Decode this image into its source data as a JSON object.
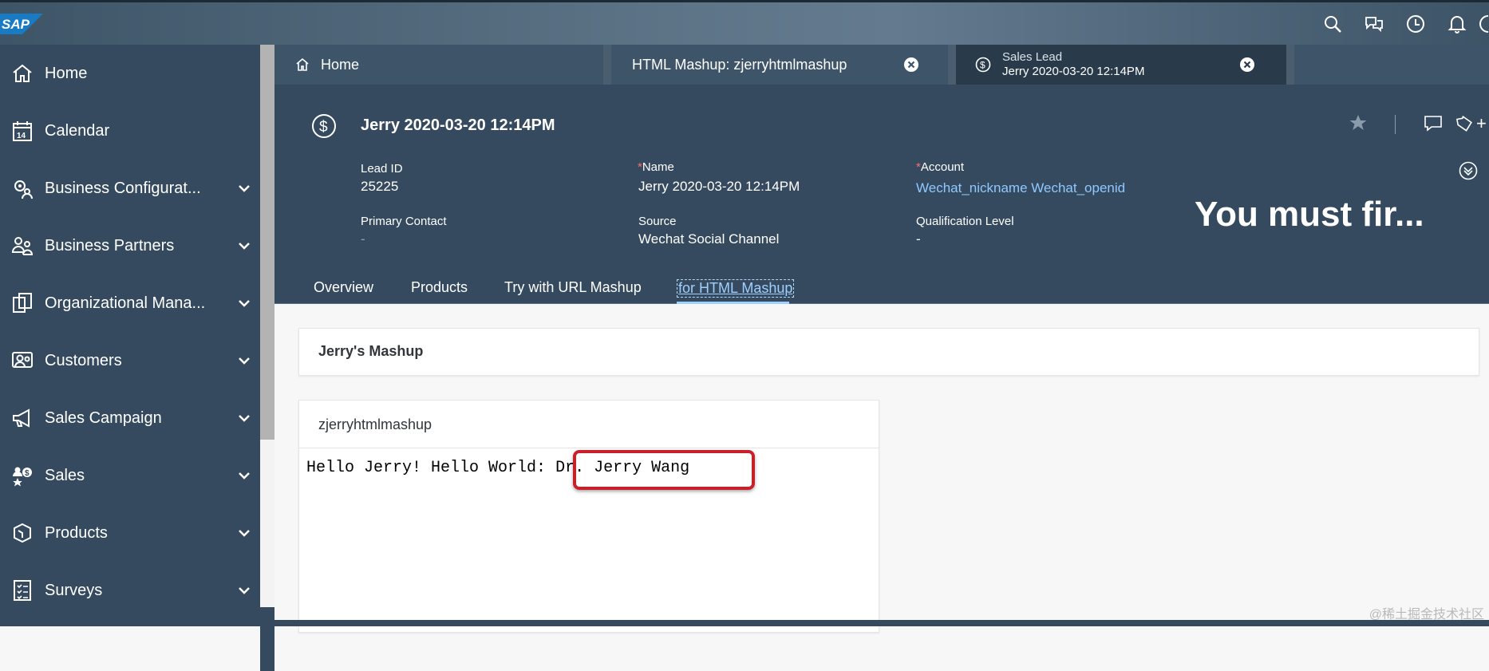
{
  "app": {
    "logo_text": "SAP",
    "colors": {
      "shell": "#354a5f",
      "accent": "#9ecfff",
      "highlight": "#c8202a"
    }
  },
  "shellbar": {
    "icons": [
      "search-icon",
      "chat-icon",
      "clock-icon",
      "bell-icon",
      "user-icon"
    ]
  },
  "sidebar": {
    "items": [
      {
        "label": "Home",
        "icon": "home-icon",
        "expandable": false
      },
      {
        "label": "Calendar",
        "icon": "calendar-icon",
        "expandable": false
      },
      {
        "label": "Business Configurat...",
        "icon": "settings-people-icon",
        "expandable": true
      },
      {
        "label": "Business Partners",
        "icon": "partners-icon",
        "expandable": true
      },
      {
        "label": "Organizational Mana...",
        "icon": "org-icon",
        "expandable": true
      },
      {
        "label": "Customers",
        "icon": "customers-icon",
        "expandable": true
      },
      {
        "label": "Sales Campaign",
        "icon": "megaphone-icon",
        "expandable": true
      },
      {
        "label": "Sales",
        "icon": "sales-icon",
        "expandable": true
      },
      {
        "label": "Products",
        "icon": "product-icon",
        "expandable": true
      },
      {
        "label": "Surveys",
        "icon": "survey-icon",
        "expandable": true
      }
    ]
  },
  "tabs": [
    {
      "label": "Home",
      "icon": "home-icon"
    },
    {
      "label": "HTML Mashup: zjerryhtmlmashup"
    },
    {
      "subtitle": "Sales Lead",
      "label": "Jerry 2020-03-20 12:14PM",
      "icon": "dollar-icon"
    }
  ],
  "header": {
    "title": "Jerry 2020-03-20 12:14PM",
    "must_text": "You must fir...",
    "fields": {
      "lead_id_label": "Lead ID",
      "lead_id": "25225",
      "name_label": "Name",
      "name": "Jerry 2020-03-20 12:14PM",
      "account_label": "Account",
      "account": "Wechat_nickname Wechat_openid",
      "primary_contact_label": "Primary Contact",
      "primary_contact": "-",
      "source_label": "Source",
      "source": "Wechat Social Channel",
      "qualification_label": "Qualification Level",
      "qualification": "-",
      "required_mark": "*"
    },
    "actions": [
      "star-icon",
      "comment-icon",
      "tag-icon"
    ],
    "plus": "+"
  },
  "subtabs": [
    {
      "label": "Overview"
    },
    {
      "label": "Products"
    },
    {
      "label": "Try with URL Mashup"
    },
    {
      "label": "for HTML Mashup",
      "active": true
    }
  ],
  "content": {
    "card_title": "Jerry's Mashup",
    "mashup_name": "zjerryhtmlmashup",
    "greeting": "Hello Jerry! Hello World: ",
    "highlight_value": "Dr. Jerry Wang"
  },
  "watermark": "@稀土掘金技术社区"
}
